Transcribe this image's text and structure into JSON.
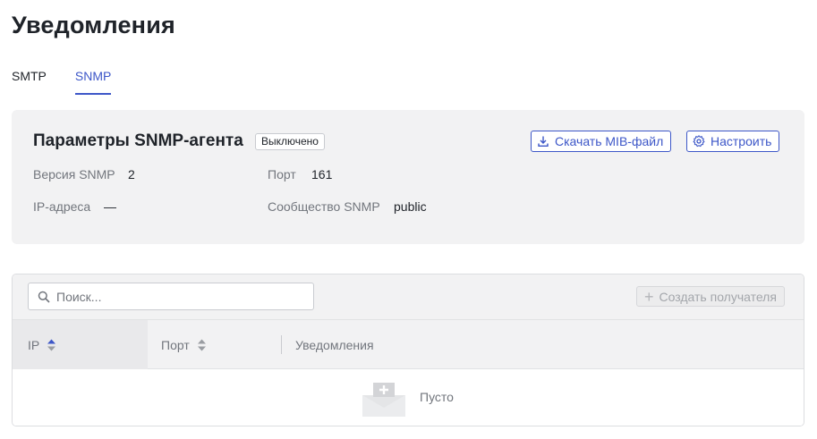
{
  "page": {
    "title": "Уведомления"
  },
  "tabs": [
    {
      "label": "SMTP",
      "active": false
    },
    {
      "label": "SNMP",
      "active": true
    }
  ],
  "agent": {
    "title": "Параметры SNMP-агента",
    "status_badge": "Выключено",
    "download_button": "Скачать MIB-файл",
    "settings_button": "Настроить",
    "fields": {
      "version_label": "Версия SNMP",
      "version_value": "2",
      "port_label": "Порт",
      "port_value": "161",
      "ip_label": "IP-адреса",
      "ip_value": "—",
      "community_label": "Сообщество SNMP",
      "community_value": "public"
    }
  },
  "recipients": {
    "search_placeholder": "Поиск...",
    "create_button": "Создать получателя",
    "columns": [
      "IP",
      "Порт",
      "Уведомления"
    ],
    "empty_text": "Пусто"
  },
  "colors": {
    "accent": "#3d57c8",
    "muted_text": "#72767d",
    "card_bg": "#f2f2f3"
  },
  "icons": {
    "download": "download-icon",
    "settings": "gear-icon",
    "search": "search-icon",
    "create": "plus-icon",
    "empty": "empty-inbox-icon"
  }
}
